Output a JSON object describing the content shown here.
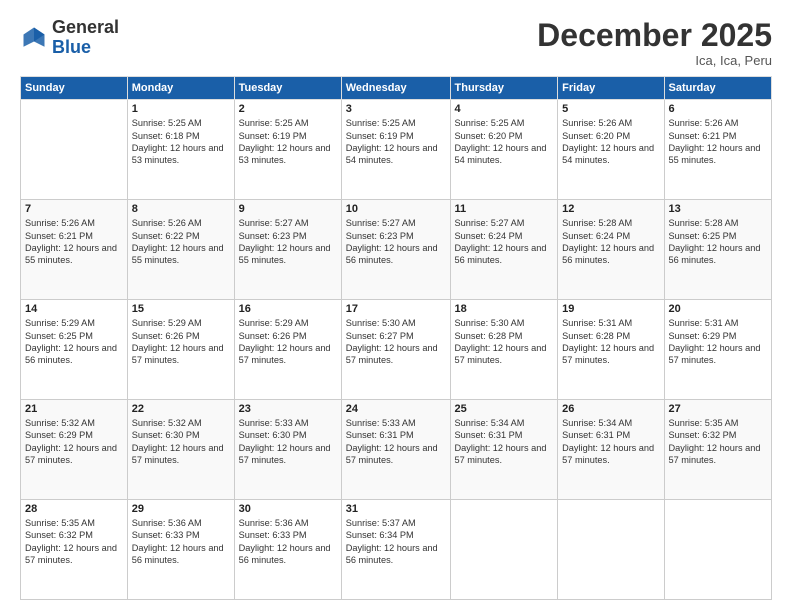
{
  "logo": {
    "general": "General",
    "blue": "Blue"
  },
  "header": {
    "month_year": "December 2025",
    "location": "Ica, Ica, Peru"
  },
  "days_of_week": [
    "Sunday",
    "Monday",
    "Tuesday",
    "Wednesday",
    "Thursday",
    "Friday",
    "Saturday"
  ],
  "weeks": [
    [
      {
        "day": "",
        "info": ""
      },
      {
        "day": "1",
        "info": "Sunrise: 5:25 AM\nSunset: 6:18 PM\nDaylight: 12 hours\nand 53 minutes."
      },
      {
        "day": "2",
        "info": "Sunrise: 5:25 AM\nSunset: 6:19 PM\nDaylight: 12 hours\nand 53 minutes."
      },
      {
        "day": "3",
        "info": "Sunrise: 5:25 AM\nSunset: 6:19 PM\nDaylight: 12 hours\nand 54 minutes."
      },
      {
        "day": "4",
        "info": "Sunrise: 5:25 AM\nSunset: 6:20 PM\nDaylight: 12 hours\nand 54 minutes."
      },
      {
        "day": "5",
        "info": "Sunrise: 5:26 AM\nSunset: 6:20 PM\nDaylight: 12 hours\nand 54 minutes."
      },
      {
        "day": "6",
        "info": "Sunrise: 5:26 AM\nSunset: 6:21 PM\nDaylight: 12 hours\nand 55 minutes."
      }
    ],
    [
      {
        "day": "7",
        "info": "Sunrise: 5:26 AM\nSunset: 6:21 PM\nDaylight: 12 hours\nand 55 minutes."
      },
      {
        "day": "8",
        "info": "Sunrise: 5:26 AM\nSunset: 6:22 PM\nDaylight: 12 hours\nand 55 minutes."
      },
      {
        "day": "9",
        "info": "Sunrise: 5:27 AM\nSunset: 6:23 PM\nDaylight: 12 hours\nand 55 minutes."
      },
      {
        "day": "10",
        "info": "Sunrise: 5:27 AM\nSunset: 6:23 PM\nDaylight: 12 hours\nand 56 minutes."
      },
      {
        "day": "11",
        "info": "Sunrise: 5:27 AM\nSunset: 6:24 PM\nDaylight: 12 hours\nand 56 minutes."
      },
      {
        "day": "12",
        "info": "Sunrise: 5:28 AM\nSunset: 6:24 PM\nDaylight: 12 hours\nand 56 minutes."
      },
      {
        "day": "13",
        "info": "Sunrise: 5:28 AM\nSunset: 6:25 PM\nDaylight: 12 hours\nand 56 minutes."
      }
    ],
    [
      {
        "day": "14",
        "info": "Sunrise: 5:29 AM\nSunset: 6:25 PM\nDaylight: 12 hours\nand 56 minutes."
      },
      {
        "day": "15",
        "info": "Sunrise: 5:29 AM\nSunset: 6:26 PM\nDaylight: 12 hours\nand 57 minutes."
      },
      {
        "day": "16",
        "info": "Sunrise: 5:29 AM\nSunset: 6:26 PM\nDaylight: 12 hours\nand 57 minutes."
      },
      {
        "day": "17",
        "info": "Sunrise: 5:30 AM\nSunset: 6:27 PM\nDaylight: 12 hours\nand 57 minutes."
      },
      {
        "day": "18",
        "info": "Sunrise: 5:30 AM\nSunset: 6:28 PM\nDaylight: 12 hours\nand 57 minutes."
      },
      {
        "day": "19",
        "info": "Sunrise: 5:31 AM\nSunset: 6:28 PM\nDaylight: 12 hours\nand 57 minutes."
      },
      {
        "day": "20",
        "info": "Sunrise: 5:31 AM\nSunset: 6:29 PM\nDaylight: 12 hours\nand 57 minutes."
      }
    ],
    [
      {
        "day": "21",
        "info": "Sunrise: 5:32 AM\nSunset: 6:29 PM\nDaylight: 12 hours\nand 57 minutes."
      },
      {
        "day": "22",
        "info": "Sunrise: 5:32 AM\nSunset: 6:30 PM\nDaylight: 12 hours\nand 57 minutes."
      },
      {
        "day": "23",
        "info": "Sunrise: 5:33 AM\nSunset: 6:30 PM\nDaylight: 12 hours\nand 57 minutes."
      },
      {
        "day": "24",
        "info": "Sunrise: 5:33 AM\nSunset: 6:31 PM\nDaylight: 12 hours\nand 57 minutes."
      },
      {
        "day": "25",
        "info": "Sunrise: 5:34 AM\nSunset: 6:31 PM\nDaylight: 12 hours\nand 57 minutes."
      },
      {
        "day": "26",
        "info": "Sunrise: 5:34 AM\nSunset: 6:31 PM\nDaylight: 12 hours\nand 57 minutes."
      },
      {
        "day": "27",
        "info": "Sunrise: 5:35 AM\nSunset: 6:32 PM\nDaylight: 12 hours\nand 57 minutes."
      }
    ],
    [
      {
        "day": "28",
        "info": "Sunrise: 5:35 AM\nSunset: 6:32 PM\nDaylight: 12 hours\nand 57 minutes."
      },
      {
        "day": "29",
        "info": "Sunrise: 5:36 AM\nSunset: 6:33 PM\nDaylight: 12 hours\nand 56 minutes."
      },
      {
        "day": "30",
        "info": "Sunrise: 5:36 AM\nSunset: 6:33 PM\nDaylight: 12 hours\nand 56 minutes."
      },
      {
        "day": "31",
        "info": "Sunrise: 5:37 AM\nSunset: 6:34 PM\nDaylight: 12 hours\nand 56 minutes."
      },
      {
        "day": "",
        "info": ""
      },
      {
        "day": "",
        "info": ""
      },
      {
        "day": "",
        "info": ""
      }
    ]
  ]
}
